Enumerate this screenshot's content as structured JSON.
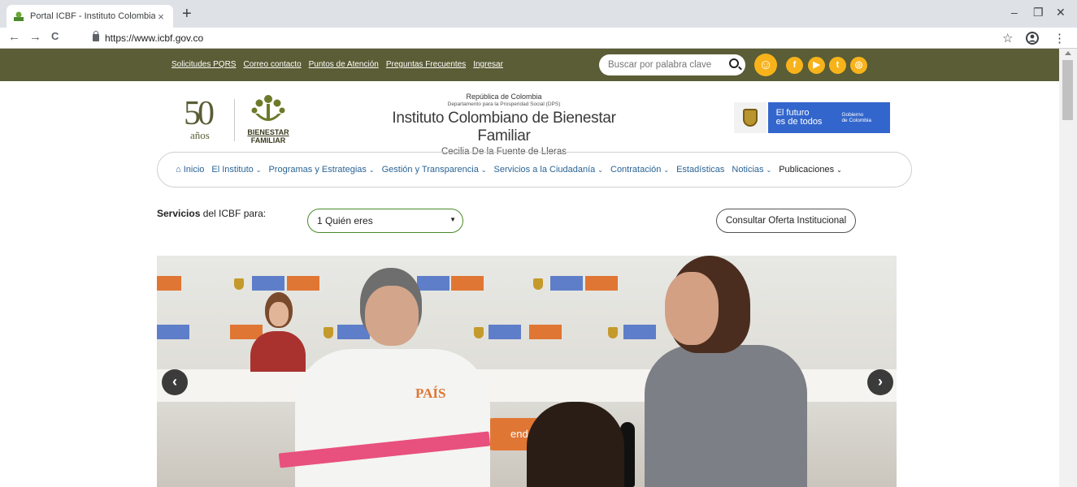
{
  "browser": {
    "tab_title": "Portal ICBF - Instituto Colombian",
    "tab_close": "×",
    "new_tab": "+",
    "url": "https://www.icbf.gov.co",
    "back": "←",
    "forward": "→",
    "reload": "C",
    "star": "☆",
    "menu": "⋮",
    "minimize": "–",
    "restore": "❐",
    "close": "✕"
  },
  "topbar": {
    "links": [
      "Solicitudes PQRS",
      "Correo contacto",
      "Puntos de Atención",
      "Preguntas Frecuentes",
      "Ingresar"
    ],
    "search_placeholder": "Buscar por palabra clave",
    "social": [
      "f",
      "▶",
      "t",
      "◎"
    ]
  },
  "brand": {
    "anniversary_number": "50",
    "anniversary_word": "años",
    "bienestar": "BIENESTAR",
    "familiar": "FAMILIAR",
    "republic": "República de Colombia",
    "department": "Departamento para la Prosperidad Social (DPS)",
    "institute": "Instituto Colombiano de Bienestar Familiar",
    "founder": "Cecilia De la Fuente de Lleras",
    "gov_slogan_1": "El futuro",
    "gov_slogan_2": "es de todos",
    "gov_name_1": "Gobierno",
    "gov_name_2": "de Colombia"
  },
  "nav": {
    "items": [
      {
        "label": "Inicio",
        "dropdown": false
      },
      {
        "label": "El Instituto",
        "dropdown": true
      },
      {
        "label": "Programas y Estrategias",
        "dropdown": true
      },
      {
        "label": "Gestión y Transparencia",
        "dropdown": true
      },
      {
        "label": "Servicios a la Ciudadanía",
        "dropdown": true
      },
      {
        "label": "Contratación",
        "dropdown": true
      },
      {
        "label": "Estadísticas",
        "dropdown": false
      },
      {
        "label": "Noticias",
        "dropdown": true
      },
      {
        "label": "Publicaciones",
        "dropdown": true
      }
    ]
  },
  "services": {
    "label_bold": "Servicios",
    "label_rest": " del ICBF para:",
    "select_value": "1  Quién eres",
    "consult_button": "Consultar Oferta Institucional"
  },
  "hero": {
    "prev": "‹",
    "next": "›",
    "shirt_text": "PAÍS",
    "sign_text": "endo"
  },
  "colors": {
    "topbar": "#5a5d35",
    "accent_yellow": "#f8b31b",
    "nav_link": "#2a6496",
    "gov_blue": "#3366cc"
  }
}
